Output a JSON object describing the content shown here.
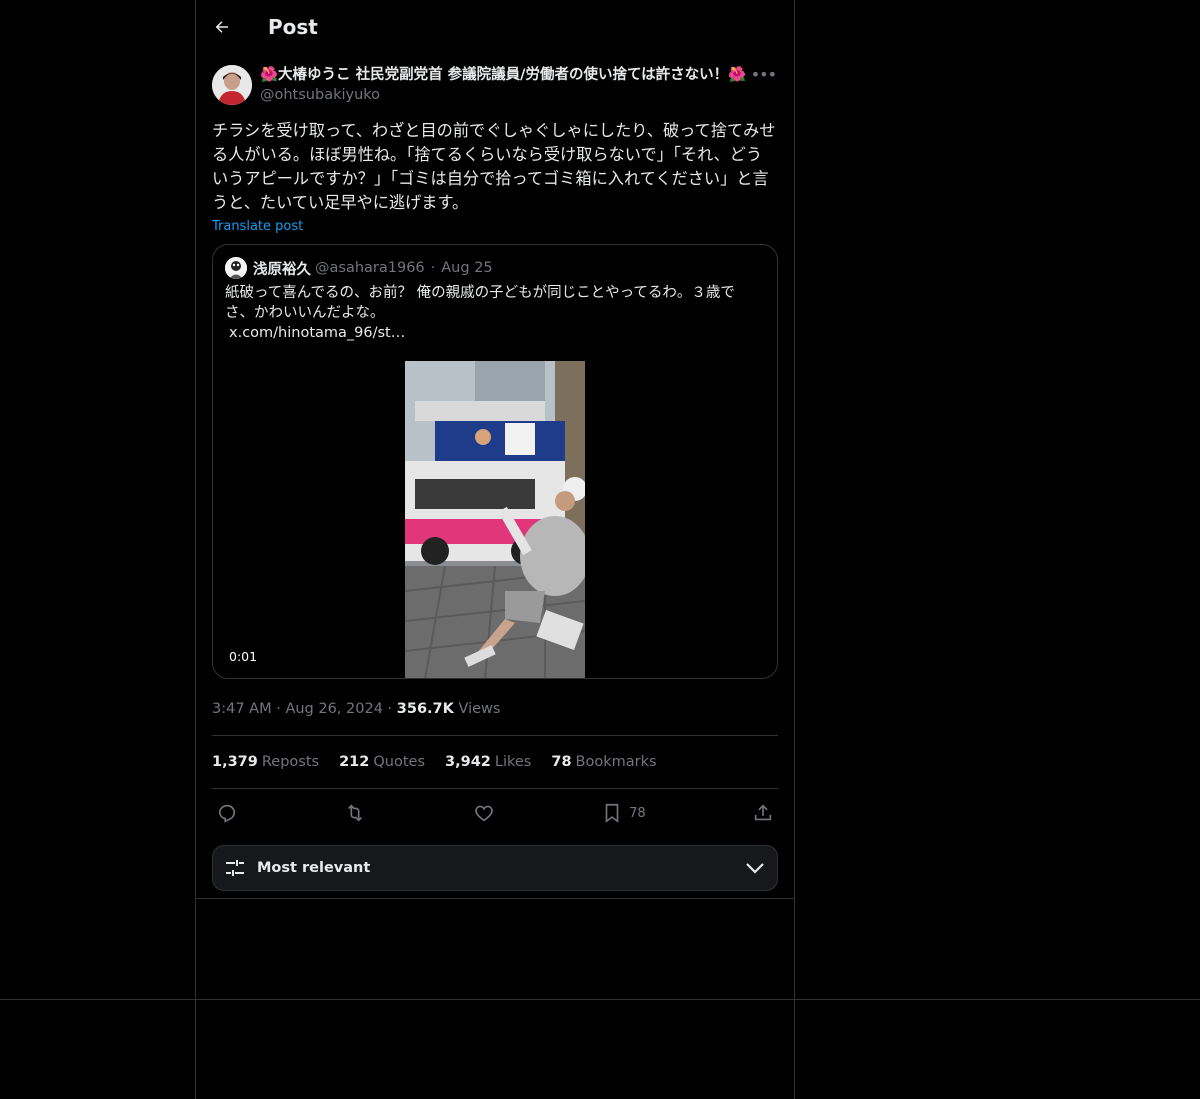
{
  "header": {
    "title": "Post"
  },
  "post": {
    "author_name": "🌺大椿ゆうこ 社民党副党首 参議院議員/労働者の使い捨ては許さない！🌺",
    "author_handle": "@ohtsubakiyuko",
    "text": "チラシを受け取って、わざと目の前でぐしゃぐしゃにしたり、破って捨てみせる人がいる。ほぼ男性ね。「捨てるくらいなら受け取らないで」「それ、どういうアピールですか？」「ゴミは自分で拾ってゴミ箱に入れてください」と言うと、たいてい足早やに逃げます。",
    "translate_label": "Translate post",
    "time": "3:47 AM",
    "date": "Aug 26, 2024",
    "views_count": "356.7K",
    "views_label": "Views"
  },
  "quote": {
    "name": "浅原裕久",
    "handle": "@asahara1966",
    "date": "Aug 25",
    "text": "紙破って喜んでるの、お前？ 俺の親戚の子どもが同じことやってるわ。３歳でさ、かわいいんだよな。",
    "link": "x.com/hinotama_96/st…",
    "video_time": "0:01"
  },
  "stats": {
    "reposts_count": "1,379",
    "reposts_label": "Reposts",
    "quotes_count": "212",
    "quotes_label": "Quotes",
    "likes_count": "3,942",
    "likes_label": "Likes",
    "bookmarks_count": "78",
    "bookmarks_label": "Bookmarks"
  },
  "actions": {
    "bookmark_count": "78"
  },
  "sort": {
    "label": "Most relevant"
  },
  "icons": [
    "back-arrow-icon",
    "more-icon",
    "reply-icon",
    "repost-icon",
    "like-icon",
    "bookmark-icon",
    "share-icon",
    "sliders-icon",
    "chevron-down-icon"
  ]
}
